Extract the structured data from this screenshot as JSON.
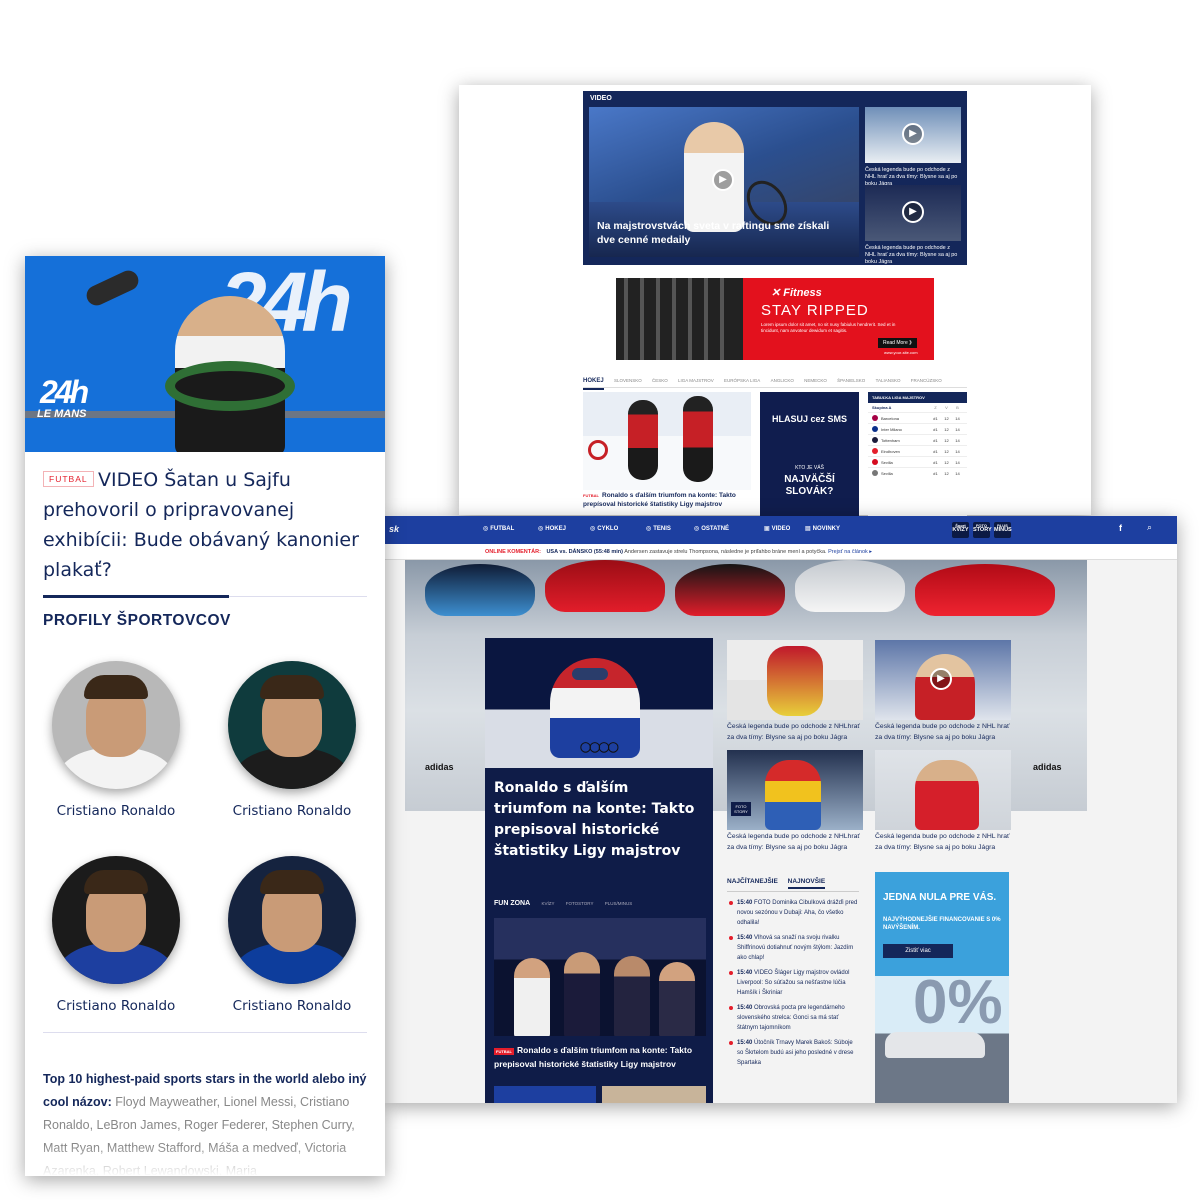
{
  "back": {
    "video_label": "VIDEO",
    "main_caption": "Na majstrovstvách sveta v raftingu sme získali dve cenné medaily",
    "side_captions": [
      "Česká legenda bude po odchode z NHL hrať za dva tímy: Blysne sa aj po boku Jágra",
      "Česká legenda bude po odchode z NHL hrať za dva tímy: Blysne sa aj po boku Jágra"
    ],
    "banner": {
      "brand": "✕ Fitness",
      "headline": "STAY RIPPED",
      "text": "Lorem ipsum dolor sit amet, no sit nusy fabiulus hendrerit. Sed et in tincidunt, nam anvoteur dewidum et sagitis.",
      "button": "Read More ⟫",
      "url": "www.your-site.com"
    },
    "hockey_tabs": [
      "HOKEJ",
      "SLOVENSKO",
      "ČESKO",
      "LIGA MAJSTROV",
      "EURÓPSKA LIGA",
      "ANGLICKO",
      "NEMECKO",
      "ŠPANIELSKO",
      "TALIANSKO",
      "FRANCÚZSKO"
    ],
    "hockey_tag": "FUTBAL",
    "hockey_caption": "Ronaldo s ďalším triumfom na konte: Takto prepísoval historické štatistiky Ligy majstrov",
    "sms_ad": {
      "line1": "HLASUJ cez SMS",
      "line2": "KTO JE VÁŠ",
      "line3": "NAJVÄČŠÍ SLOVÁK?"
    },
    "table": {
      "title": "TABUĽKA LIGA MAJSTROV",
      "group": "Skupina A",
      "cols": [
        "Z",
        "V",
        "B"
      ],
      "rows": [
        {
          "team": "Barcelona",
          "z": "#1",
          "v": "12",
          "b": "14",
          "color": "#a50044"
        },
        {
          "team": "Inter Milano",
          "z": "#1",
          "v": "12",
          "b": "14",
          "color": "#0a2f8a"
        },
        {
          "team": "Tottenham",
          "z": "#1",
          "v": "12",
          "b": "14",
          "color": "#1b1b3a"
        },
        {
          "team": "Eindhoven",
          "z": "#1",
          "v": "12",
          "b": "14",
          "color": "#e41e2b"
        },
        {
          "team": "Sevilla",
          "z": "#1",
          "v": "12",
          "b": "14",
          "color": "#d60b1f"
        },
        {
          "team": "Sevilla",
          "z": "#1",
          "v": "12",
          "b": "14",
          "color": "#777777"
        }
      ]
    }
  },
  "front": {
    "logo": "sk",
    "nav": [
      "FUTBAL",
      "HOKEJ",
      "CYKLO",
      "TENIS",
      "OSTATNÉ",
      "VIDEO",
      "NOVINKY"
    ],
    "pills": [
      {
        "top": "Šport",
        "main": "KVÍZY"
      },
      {
        "top": "FOTO",
        "main": "STORY"
      },
      {
        "top": "PLUS",
        "main": "MÍNUS"
      }
    ],
    "facebook": "f",
    "live_label": "ONLINE KOMENTÁR:",
    "live_match": "USA vs. DÁNSKO (55:48 min)",
    "live_text": "Andersen zastavuje strelu Thompsona, následne je priľahbo bráne mení a potyčka.",
    "live_link": "Prejsť na článok ▸",
    "brand_left": "adidas",
    "brand_right": "adidas",
    "main_title": "Ronaldo s ďalším triumfom na konte: Takto prepisoval historické štatistiky Ligy majstrov",
    "fun_tabs": [
      "FUN ZONA",
      "KVÍZY",
      "FOTOSTORY",
      "PLUS/MINUS"
    ],
    "fun_tag": "FUTBAL",
    "fun_caption": "Ronaldo s ďalším triumfom na konte: Takto prepisoval historické štatistiky Ligy majstrov",
    "tile_captions": [
      "Česká legenda bude po odchode z NHLhrať za dva tímy: Blysne sa aj po boku Jágra",
      "Česká legenda bude po odchode z NHL hrať za dva tímy: Blysne sa aj po boku Jágra",
      "Česká legenda bude po odchode z NHLhrať za dva tímy: Blysne sa aj po boku Jágra",
      "Česká legenda bude po odchode z NHL hrať za dva tímy: Blysne sa aj po boku Jágra"
    ],
    "foto_story_badge": "FOTO STORY",
    "news_tabs": [
      "NAJČÍTANEJŠIE",
      "NAJNOVŠIE"
    ],
    "news": [
      {
        "time": "15:40",
        "text": "FOTO Dominika Cibulková drážďi pred novou sezónou v Dubaji: Aha, čo všetko odhalila!"
      },
      {
        "time": "15:40",
        "text": "Vlhová sa snaží na svoju rivalku Shiffrinovú dotiahnuť novým štýlom: Jazdím ako chlap!"
      },
      {
        "time": "15:40",
        "text": "VIDEO Šláger Ligy majstrov ovládol Liverpool: So súťažou sa nešťastne lúčia Hamšík i Škriniar"
      },
      {
        "time": "15:40",
        "text": "Obrovská pocta pre legendárneho slovenského strelca: Gonci sa má stať štátnym tajomníkom"
      },
      {
        "time": "15:40",
        "text": "Útočník Trnavy Marek Bakoš: Súboje so Škrtelom budú asi jeho posledné v drese Spartaka"
      }
    ],
    "bmw_ad": {
      "line1": "JEDNA NULA PRE VÁS.",
      "line2": "NAJVÝHODNEJŠIE FINANCOVANIE S 0% NAVÝŠENÍM.",
      "button": "Zistiť viac",
      "big": "0%"
    }
  },
  "mobile": {
    "tag": "FUTBAL",
    "title": "VIDEO Šatan u Sajfu prehovoril o pripravovanej exhibícii: Bude obávaný kanonier plakať?",
    "hero_text": "24h",
    "hero_small": "24h",
    "hero_lemans": "LE MANS",
    "section_title": "PROFILY ŠPORTOVCOV",
    "profiles": [
      {
        "name": "Cristiano Ronaldo",
        "shirt": "#f3f3f3",
        "bg": "#b8b8b8"
      },
      {
        "name": "Cristiano Ronaldo",
        "shirt": "#1c1c1c",
        "bg": "#0f3b3d"
      },
      {
        "name": "Cristiano Ronaldo",
        "shirt": "#1d3fa0",
        "bg": "#1b1b1b"
      },
      {
        "name": "Cristiano Ronaldo",
        "shirt": "#0d3d9c",
        "bg": "#15233f"
      }
    ],
    "top_label": "Top 10 highest-paid sports stars in the world alebo iný cool názov:",
    "top_list": "Floyd Mayweather, Lionel Messi, Cristiano Ronaldo, LeBron James, Roger Federer, Stephen Curry, Matt Ryan, Matthew Stafford, Máša a medveď, Victoria Azarenka, Robert Lewandowski, Maria"
  }
}
